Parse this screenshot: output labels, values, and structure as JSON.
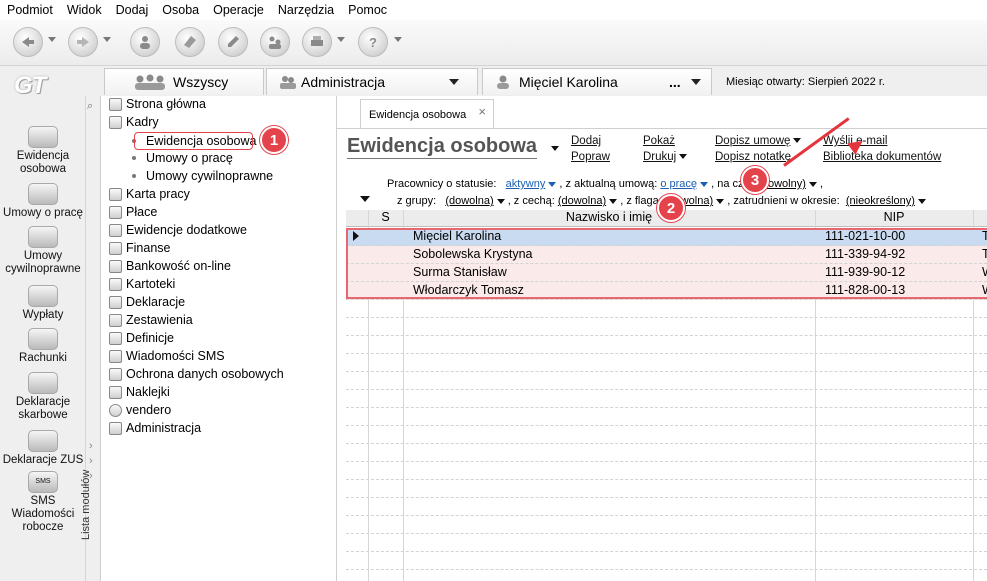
{
  "menu": [
    "Podmiot",
    "Widok",
    "Dodaj",
    "Osoba",
    "Operacje",
    "Narzędzia",
    "Pomoc"
  ],
  "logo": "GT",
  "top_tabs": {
    "all": "Wszyscy",
    "admin": "Administracja",
    "person": "Mięciel Karolina",
    "person_more": "...",
    "month": "Miesiąc otwarty: Sierpień 2022 r."
  },
  "left_modules": [
    {
      "label": "Ewidencja osobowa"
    },
    {
      "label": "Umowy o pracę"
    },
    {
      "label": "Umowy cywilnoprawne"
    },
    {
      "label": "Wypłaty"
    },
    {
      "label": "Rachunki"
    },
    {
      "label": "Deklaracje skarbowe"
    },
    {
      "label": "Deklaracje ZUS"
    },
    {
      "label": "SMS Wiadomości robocze",
      "icon_text": "SMS"
    }
  ],
  "modules_strip_label": "Lista modułów",
  "tree": {
    "items": [
      {
        "label": "Strona główna"
      },
      {
        "label": "Kadry"
      },
      {
        "label": "Ewidencja osobowa"
      },
      {
        "label": "Umowy o pracę"
      },
      {
        "label": "Umowy cywilnoprawne"
      },
      {
        "label": "Karta pracy"
      },
      {
        "label": "Płace"
      },
      {
        "label": "Ewidencje dodatkowe"
      },
      {
        "label": "Finanse"
      },
      {
        "label": "Bankowość on-line"
      },
      {
        "label": "Kartoteki"
      },
      {
        "label": "Deklaracje"
      },
      {
        "label": "Zestawienia"
      },
      {
        "label": "Definicje"
      },
      {
        "label": "Wiadomości SMS"
      },
      {
        "label": "Ochrona danych osobowych"
      },
      {
        "label": "Naklejki"
      },
      {
        "label": "vendero"
      },
      {
        "label": "Administracja"
      }
    ]
  },
  "badges": [
    "1",
    "2",
    "3"
  ],
  "subtab": {
    "label": "Ewidencja osobowa",
    "close": "×"
  },
  "page": {
    "title": "Ewidencja osobowa",
    "actions": {
      "dodaj": "Dodaj",
      "popraw": "Popraw",
      "pokaz": "Pokaż",
      "drukuj": "Drukuj",
      "dopisz_umowe": "Dopisz umowę",
      "dopisz_notatke": "Dopisz notatkę",
      "wyslij": "Wyślij e-mail",
      "biblioteka": "Biblioteka dokumentów"
    }
  },
  "filters": {
    "l1_a": "Pracownicy o statusie:",
    "status": "aktywny",
    "l1_b": ", z aktualną umową:",
    "umowa": "o pracę",
    "l1_c": ", na czas",
    "czas": "(dowolny)",
    "l1_d": ",",
    "l2_a": "z grupy:",
    "grupa": "(dowolna)",
    "l2_b": ", z cechą:",
    "cecha": "(dowolna)",
    "l2_c": ", z flagą:",
    "flaga": "(dowolna)",
    "l2_d": ", zatrudnieni w okresie:",
    "okres": "(nieokreślony)"
  },
  "grid": {
    "headers": {
      "s": "S",
      "name": "Nazwisko i imię",
      "nip": "NIP"
    },
    "rows": [
      {
        "name": "Mięciel Karolina",
        "nip": "111-021-10-00",
        "extra": "T"
      },
      {
        "name": "Sobolewska Krystyna",
        "nip": "111-339-94-92",
        "extra": "T"
      },
      {
        "name": "Surma Stanisław",
        "nip": "111-939-90-12",
        "extra": "W"
      },
      {
        "name": "Włodarczyk Tomasz",
        "nip": "111-828-00-13",
        "extra": "W"
      }
    ]
  },
  "colors": {
    "accent": "#e4434c",
    "link": "#1b5fb4",
    "selected_row": "#c9dbf0"
  }
}
